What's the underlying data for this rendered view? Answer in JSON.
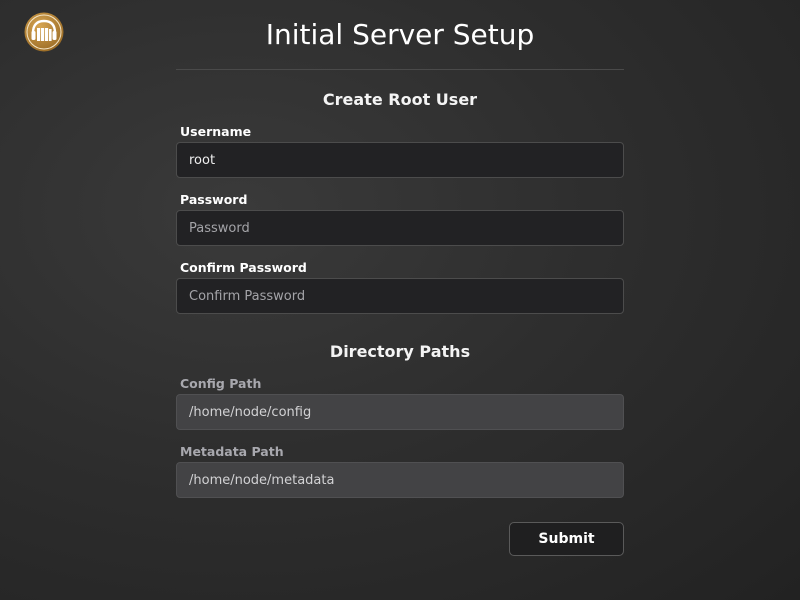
{
  "logo": {
    "icon": "headphones-books-icon",
    "accent": "#b8873a"
  },
  "page": {
    "title": "Initial Server Setup"
  },
  "root_user": {
    "heading": "Create Root User",
    "username": {
      "label": "Username",
      "value": "root",
      "placeholder": ""
    },
    "password": {
      "label": "Password",
      "value": "",
      "placeholder": "Password"
    },
    "confirm_password": {
      "label": "Confirm Password",
      "value": "",
      "placeholder": "Confirm Password"
    }
  },
  "directory_paths": {
    "heading": "Directory Paths",
    "config_path": {
      "label": "Config Path",
      "value": "/home/node/config"
    },
    "metadata_path": {
      "label": "Metadata Path",
      "value": "/home/node/metadata"
    }
  },
  "actions": {
    "submit_label": "Submit"
  },
  "colors": {
    "background": "#2e2e2e",
    "input_background": "#222224",
    "readonly_input_background": "#434345",
    "logo_gold": "#b8873a"
  }
}
